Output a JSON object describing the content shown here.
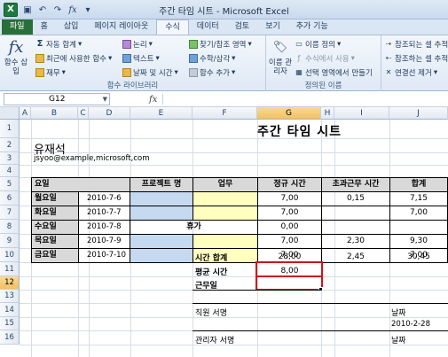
{
  "window": {
    "title": "주간 타임 시트 - Microsoft Excel",
    "app_icon": "X"
  },
  "qat": [
    "save-icon",
    "undo-icon",
    "redo-icon",
    "function-icon"
  ],
  "tabs": [
    "파일",
    "홈",
    "삽입",
    "페이지 레이아웃",
    "수식",
    "데이터",
    "검토",
    "보기",
    "추가 기능"
  ],
  "ribbon": {
    "insert_function": "함수 삽입",
    "autosum": "자동 합계",
    "recent": "최근에 사용한 함수",
    "financial": "재무",
    "logical": "논리",
    "text": "텍스트",
    "datetime": "날짜 및 시간",
    "lookup": "찾기/참조 영역",
    "math": "수학/삼각",
    "more": "함수 추가",
    "group1_label": "함수 라이브러리",
    "name_manager": "이름 관리자",
    "define_name": "이름 정의",
    "use_in_formula": "수식에서 사용",
    "create_from_selection": "선택 영역에서 만들기",
    "group2_label": "정의된 이름",
    "trace_precedents": "참조되는 셀 추적",
    "trace_dependents": "참조하는 셀 추적",
    "remove_arrows": "연결선 제거"
  },
  "formula_bar": {
    "name_box": "G12",
    "fx": "fx",
    "formula": ""
  },
  "columns": [
    "A",
    "B",
    "C",
    "D",
    "E",
    "F",
    "G",
    "H",
    "I",
    "J"
  ],
  "rows": [
    "1",
    "2",
    "3",
    "4",
    "5",
    "6",
    "7",
    "8",
    "9",
    "10",
    "11",
    "12",
    "13",
    "14",
    "15",
    "16"
  ],
  "sheet": {
    "title": "주간 타임 시트",
    "name": "유재석",
    "email": "jsyoo@example,microsoft,com",
    "headers": {
      "day": "요일",
      "project": "프로젝트 명",
      "task": "업무",
      "regular": "정규 시간",
      "overtime": "초과근무 시간",
      "total": "합계"
    },
    "days": [
      {
        "day": "월요일",
        "date": "2010-7-6",
        "regular": "7,00",
        "overtime": "0,15",
        "total": "7,15"
      },
      {
        "day": "화요일",
        "date": "2010-7-7",
        "regular": "7,00",
        "overtime": "",
        "total": "7,00"
      },
      {
        "day": "수요일",
        "date": "2010-7-8",
        "holiday": "휴가",
        "regular": "0,00",
        "overtime": "",
        "total": ""
      },
      {
        "day": "목요일",
        "date": "2010-7-9",
        "regular": "7,00",
        "overtime": "2,30",
        "total": "9,30"
      },
      {
        "day": "금요일",
        "date": "2010-7-10",
        "regular": "7,00",
        "overtime": "",
        "total": "7,00"
      }
    ],
    "total_label": "시간 합계",
    "total_regular": "28,00",
    "total_overtime": "2,45",
    "total_total": "30,45",
    "avg_label": "평균 시간",
    "avg_value": "8,00",
    "workdays_label": "근무일",
    "employee_sign": "직원 서명",
    "manager_sign": "관리자 서명",
    "date_label": "날짜",
    "date_value": "2010-2-28",
    "date_label2": "날짜"
  },
  "colors": {
    "accent_file_tab": "#2a6f3a",
    "highlight_box": "#d01414",
    "project_fill": "#c5d9f1",
    "task_fill": "#ffffc0",
    "header_fill": "#d9d9d9"
  }
}
